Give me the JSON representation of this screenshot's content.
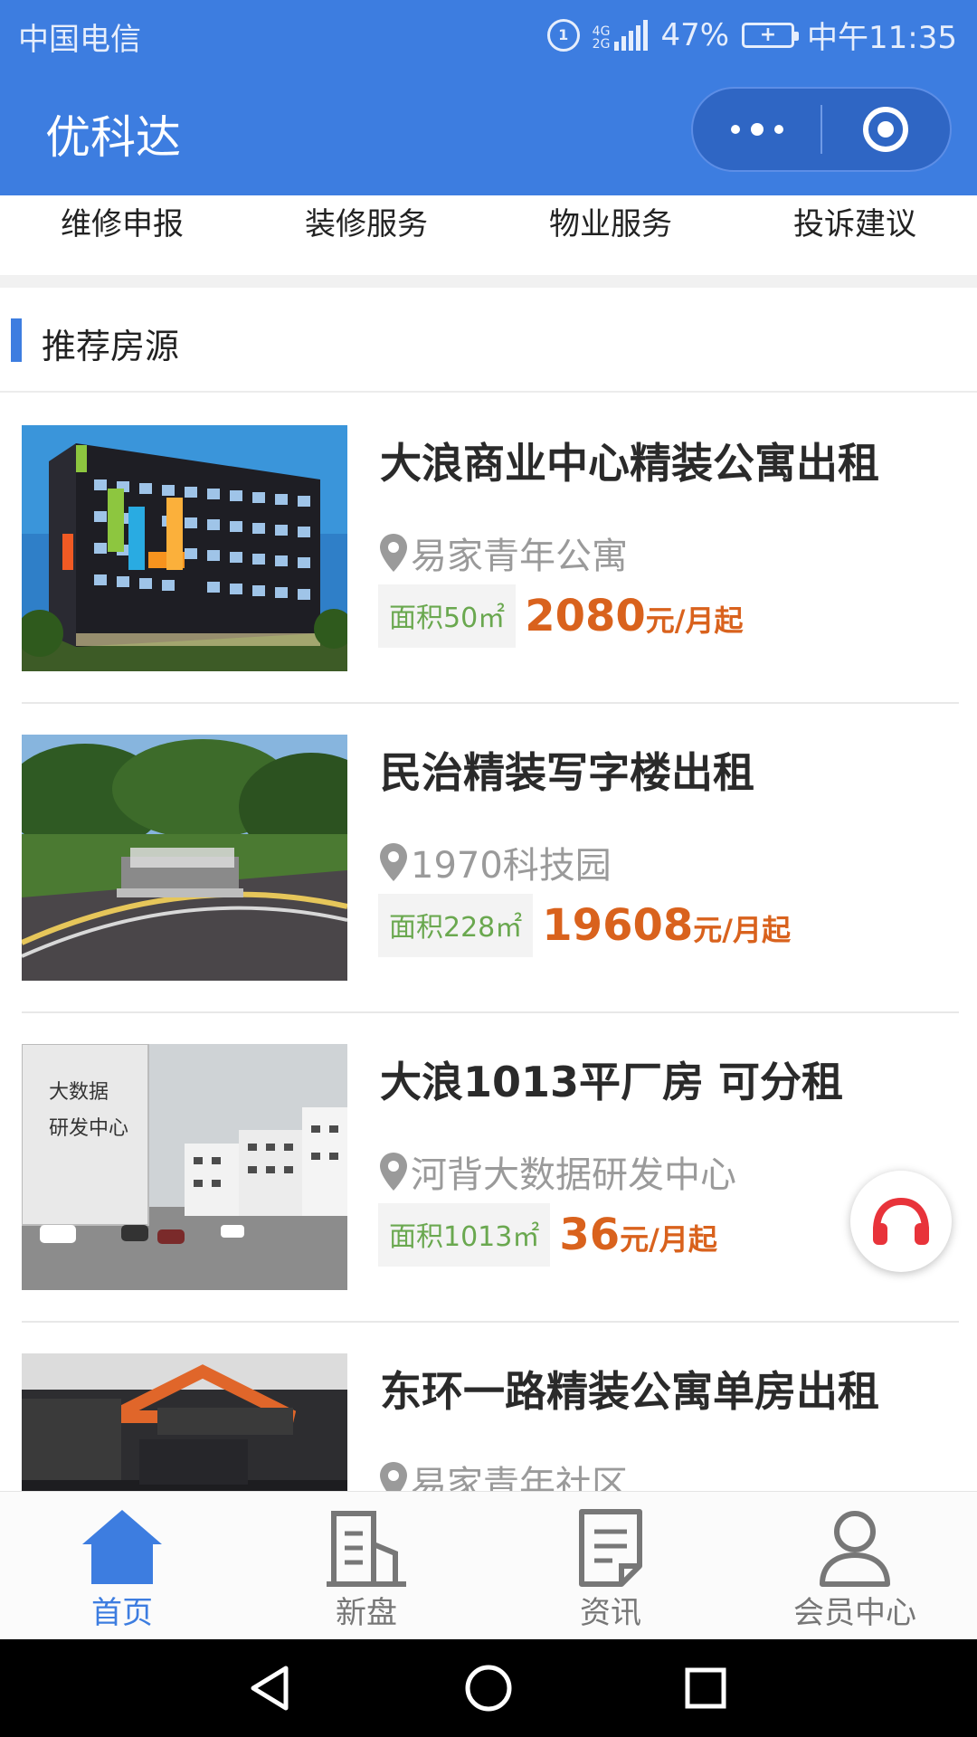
{
  "status_bar": {
    "carrier": "中国电信",
    "network": "4G 2G",
    "battery": "47%",
    "time": "中午11:35"
  },
  "header": {
    "title": "优科达",
    "accent_color": "#3d7de0"
  },
  "services": [
    {
      "label": "维修申报"
    },
    {
      "label": "装修服务"
    },
    {
      "label": "物业服务"
    },
    {
      "label": "投诉建议"
    }
  ],
  "section": {
    "title": "推荐房源"
  },
  "listings": [
    {
      "title": "大浪商业中心精装公寓出租",
      "location": "易家青年公寓",
      "area": "面积50㎡",
      "price": "2080",
      "unit": "元/月起"
    },
    {
      "title": "民治精装写字楼出租",
      "location": "1970科技园",
      "area": "面积228㎡",
      "price": "19608",
      "unit": "元/月起"
    },
    {
      "title": "大浪1013平厂房 可分租",
      "location": "河背大数据研发中心",
      "area": "面积1013㎡",
      "price": "36",
      "unit": "元/月起"
    },
    {
      "title": "东环一路精装公寓单房出租",
      "location": "易家青年社区",
      "area": "",
      "price": "",
      "unit": ""
    }
  ],
  "tabs": [
    {
      "label": "首页",
      "icon": "home-icon",
      "active": true
    },
    {
      "label": "新盘",
      "icon": "building-icon",
      "active": false
    },
    {
      "label": "资讯",
      "icon": "news-icon",
      "active": false
    },
    {
      "label": "会员中心",
      "icon": "user-icon",
      "active": false
    }
  ],
  "price_color": "#d9621d",
  "area_color": "#6aa84f"
}
